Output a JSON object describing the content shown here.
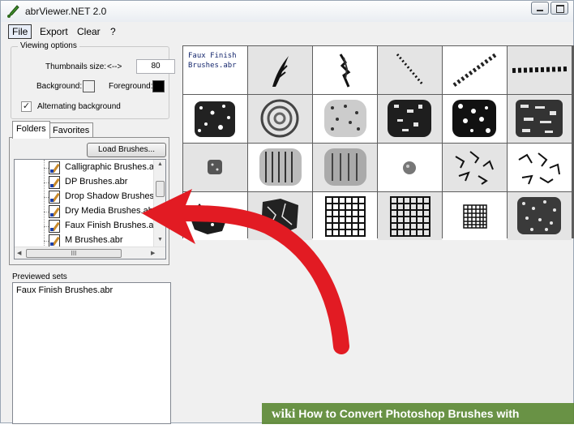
{
  "window": {
    "title": "abrViewer.NET 2.0",
    "accent": "#e21b23"
  },
  "menu": {
    "items": [
      "File",
      "Export",
      "Clear",
      "?"
    ]
  },
  "viewing_options": {
    "legend": "Viewing options",
    "thumbnails_label": "Thumbnails size:",
    "thumbnails_arrow": "<-->",
    "thumbnails_value": "80",
    "background_label": "Background:",
    "background_color": "#f0f0f0",
    "foreground_label": "Foreground:",
    "foreground_color": "#000000",
    "alternating_label": "Alternating background",
    "alternating_checked": true,
    "check_mark": "✓"
  },
  "tabs": [
    "Folders",
    "Favorites"
  ],
  "folders": {
    "load_button": "Load Brushes...",
    "items": [
      "Calligraphic Brushes.abr",
      "DP Brushes.abr",
      "Drop Shadow Brushes.abr",
      "Dry Media Brushes.abr",
      "Faux Finish Brushes.abr",
      "M Brushes.abr"
    ],
    "scroll_grip": "III"
  },
  "previewed": {
    "label": "Previewed sets",
    "items": [
      "Faux Finish Brushes.abr"
    ]
  },
  "grid": {
    "set_name_line1": "Faux Finish",
    "set_name_line2": "Brushes.abr",
    "thumbnail_icons": [
      "feather-brush",
      "streak-brush",
      "dotted-line-brush",
      "chain-dots-brush",
      "dash-row-brush",
      "sponge-brush",
      "swirl-brush",
      "speckle-brush",
      "rough-texture-brush",
      "dense-texture-brush",
      "scatter-texture-brush",
      "small-sponge-brush",
      "vertical-streak-brush",
      "stipple-brush",
      "tiny-dot-brush",
      "crumple-brush",
      "crumple-brush-2",
      "rough-edge-brush",
      "cracked-brush",
      "grid-brush",
      "grid-brush-2",
      "small-grid-brush",
      "noise-brush"
    ]
  },
  "watermark": {
    "logo": "wiki",
    "text": "How to Convert Photoshop Brushes with abrViewer"
  }
}
